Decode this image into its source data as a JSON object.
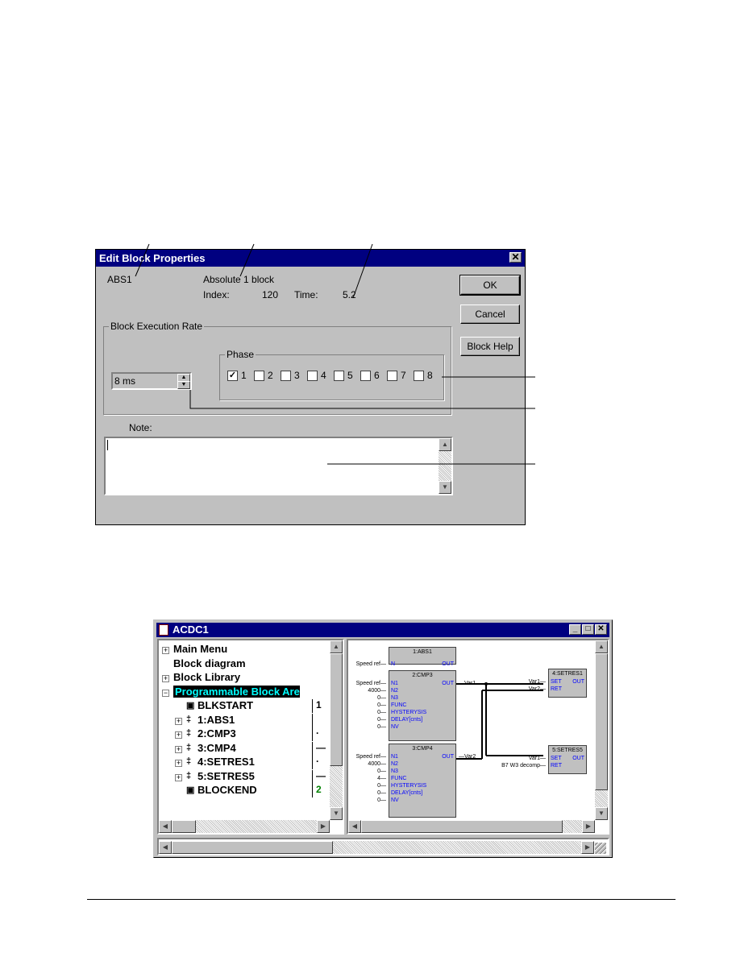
{
  "dialog": {
    "title": "Edit Block Properties",
    "close_glyph": "✕",
    "block_name": "ABS1",
    "block_desc": "Absolute 1 block",
    "index_label": "Index:",
    "index_value": "120",
    "time_label": "Time:",
    "time_value": "5.2",
    "buttons": {
      "ok": "OK",
      "cancel": "Cancel",
      "help": "Block Help"
    },
    "exec_rate_group": "Block Execution Rate",
    "exec_rate_value": "8 ms",
    "phase_group": "Phase",
    "phases": [
      {
        "label": "1",
        "checked": true
      },
      {
        "label": "2",
        "checked": false
      },
      {
        "label": "3",
        "checked": false
      },
      {
        "label": "4",
        "checked": false
      },
      {
        "label": "5",
        "checked": false
      },
      {
        "label": "6",
        "checked": false
      },
      {
        "label": "7",
        "checked": false
      },
      {
        "label": "8",
        "checked": false
      }
    ],
    "note_label": "Note:",
    "note_value": ""
  },
  "window": {
    "title": "ACDC1",
    "tree": [
      {
        "label": "Main Menu",
        "expander": "+"
      },
      {
        "label": "Block diagram",
        "expander": ""
      },
      {
        "label": "Block Library",
        "expander": "+"
      },
      {
        "label": "Programmable Block Area",
        "expander": "-"
      },
      {
        "label": "BLKSTART",
        "expander": ""
      },
      {
        "label": "1:ABS1",
        "expander": "+"
      },
      {
        "label": "2:CMP3",
        "expander": "+"
      },
      {
        "label": "3:CMP4",
        "expander": "+"
      },
      {
        "label": "4:SETRES1",
        "expander": "+"
      },
      {
        "label": "5:SETRES5",
        "expander": "+"
      },
      {
        "label": "BLOCKEND",
        "expander": ""
      }
    ],
    "tree_values": [
      "1",
      "",
      "·",
      "—",
      "·",
      "—",
      "2"
    ],
    "diagram": {
      "abs1": {
        "title": "1:ABS1",
        "in": [
          "N"
        ],
        "out": "OUT",
        "ext_in": [
          "Speed ref"
        ]
      },
      "cmp3": {
        "title": "2:CMP3",
        "in": [
          "N1",
          "N2",
          "N3",
          "FUNC",
          "HYSTERYSIS",
          "DELAY[cnts]",
          "NV"
        ],
        "out": "OUT",
        "ext_in": [
          "Speed ref",
          "4000",
          "0",
          "0",
          "0",
          "0",
          "0"
        ],
        "ext_out": "Var1"
      },
      "cmp4": {
        "title": "3:CMP4",
        "in": [
          "N1",
          "N2",
          "N3",
          "FUNC",
          "HYSTERYSIS",
          "DELAY[cnts]",
          "NV"
        ],
        "out": "OUT",
        "ext_in": [
          "Speed ref",
          "4000",
          "0",
          "4",
          "0",
          "0",
          "0"
        ],
        "ext_out": "Var2"
      },
      "setres1": {
        "title": "4:SETRES1",
        "in": [
          "SET",
          "RET"
        ],
        "out": "OUT",
        "ext_in": [
          "Var1",
          "Var2"
        ]
      },
      "setres5": {
        "title": "5:SETRES5",
        "in": [
          "SET",
          "RET"
        ],
        "out": "OUT",
        "ext_in": [
          "Var1",
          "B7 W3 decomp"
        ]
      }
    }
  }
}
